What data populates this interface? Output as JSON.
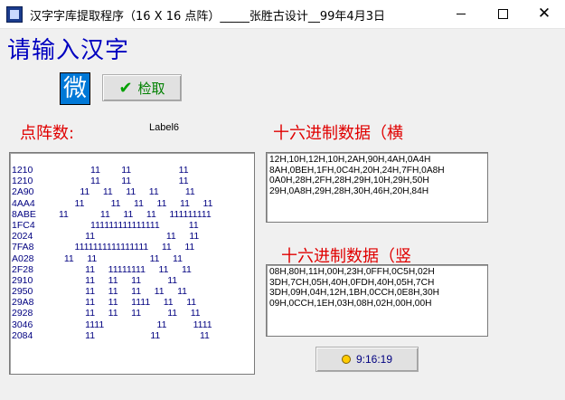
{
  "window": {
    "title": "汉字字库提取程序（16 X 16 点阵）_____张胜古设计__99年4月3日"
  },
  "heading": "请输入汉字",
  "input": {
    "value": "微"
  },
  "retrieve_button": {
    "label": "检取"
  },
  "labels": {
    "dot_matrix": "点阵数:",
    "label6": "Label6",
    "hex_horizontal": "十六进制数据（横",
    "hex_vertical": "十六进制数据（竖"
  },
  "matrix_rows": [
    {
      "code": "1210",
      "bits": "            11        11                  11"
    },
    {
      "code": "1210",
      "bits": "            11        11                  11"
    },
    {
      "code": "2A90",
      "bits": "        11     11     11     11          11"
    },
    {
      "code": "4AA4",
      "bits": "      11          11     11     11     11     11"
    },
    {
      "code": "8ABE",
      "bits": "11            11     11     11     111111111"
    },
    {
      "code": "1FC4",
      "bits": "            111111111111111           11"
    },
    {
      "code": "2024",
      "bits": "          11                           11     11"
    },
    {
      "code": "7FA8",
      "bits": "      1111111111111111     11     11"
    },
    {
      "code": "A028",
      "bits": "  11     11                    11     11"
    },
    {
      "code": "2F28",
      "bits": "          11     11111111     11     11"
    },
    {
      "code": "2910",
      "bits": "          11     11     11          11"
    },
    {
      "code": "2950",
      "bits": "          11     11     11     11     11"
    },
    {
      "code": "29A8",
      "bits": "          11     11     1111     11     11"
    },
    {
      "code": "2928",
      "bits": "          11     11     11          11     11"
    },
    {
      "code": "3046",
      "bits": "          1111                    11          1111"
    },
    {
      "code": "2084",
      "bits": "          11                     11               11"
    }
  ],
  "hex_horizontal": [
    "12H,10H,12H,10H,2AH,90H,4AH,0A4H",
    "8AH,0BEH,1FH,0C4H,20H,24H,7FH,0A8H",
    "0A0H,28H,2FH,28H,29H,10H,29H,50H",
    "29H,0A8H,29H,28H,30H,46H,20H,84H"
  ],
  "hex_vertical": [
    "08H,80H,11H,00H,23H,0FFH,0C5H,02H",
    "3DH,7CH,05H,40H,0FDH,40H,05H,7CH",
    "3DH,09H,04H,12H,1BH,0CCH,0E8H,30H",
    "09H,0CCH,1EH,03H,08H,02H,00H,00H"
  ],
  "clock": {
    "time": "9:16:19"
  },
  "colors": {
    "heading": "#0000c0",
    "label_red": "#e00000",
    "input_bg": "#0078d7",
    "button_text": "#008000"
  }
}
